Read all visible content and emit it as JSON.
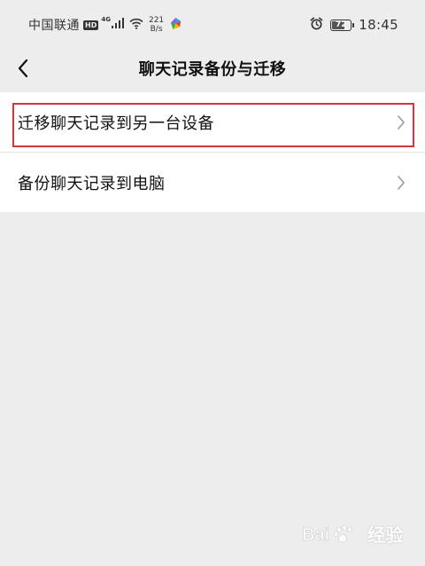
{
  "status_bar": {
    "carrier": "中国联通",
    "hd_badge": "HD",
    "network_type": "4G",
    "speed_value": "221",
    "speed_unit": "B/s",
    "battery_level": "72",
    "time": "18:45",
    "icons": [
      "signal-icon",
      "wifi-icon",
      "app-icon",
      "alarm-icon",
      "battery-icon"
    ]
  },
  "nav": {
    "title": "聊天记录备份与迁移",
    "back_icon": "chevron-left-icon"
  },
  "menu": {
    "items": [
      {
        "label": "迁移聊天记录到另一台设备",
        "highlighted": true
      },
      {
        "label": "备份聊天记录到电脑",
        "highlighted": false
      }
    ]
  },
  "colors": {
    "background": "#ededed",
    "card": "#ffffff",
    "highlight_border": "#d9333b"
  },
  "watermark": {
    "text": "经验",
    "logo": "Bai du"
  }
}
